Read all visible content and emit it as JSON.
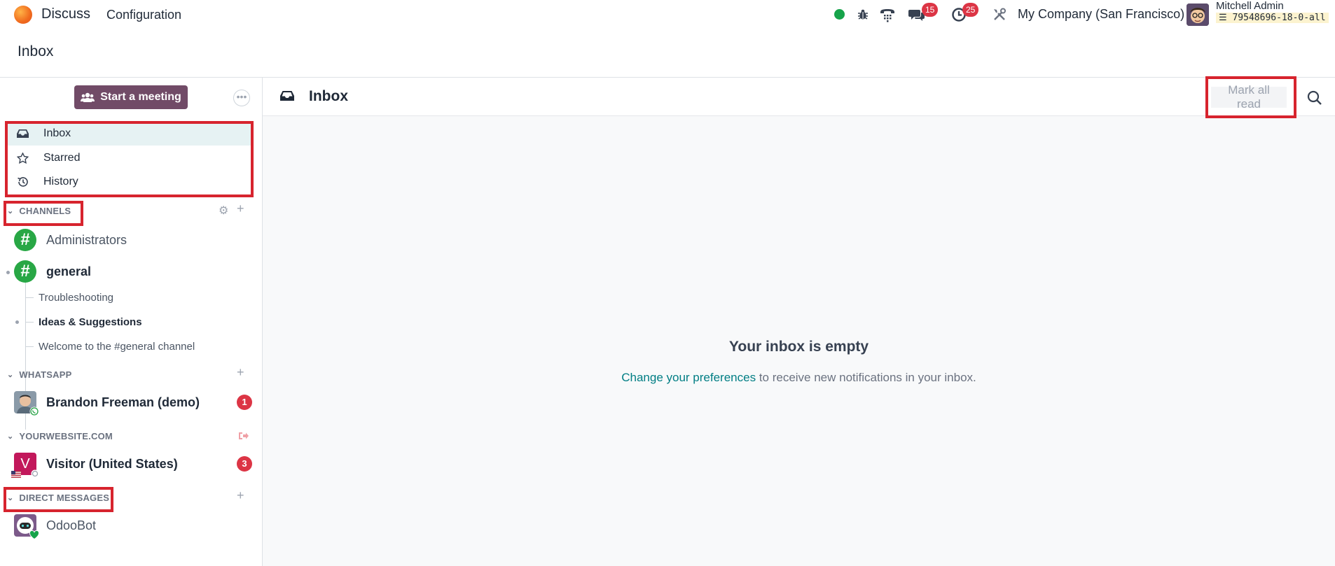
{
  "navbar": {
    "app_name": "Discuss",
    "menu_configuration": "Configuration",
    "messages_count": "15",
    "activities_count": "25",
    "company": "My Company (San Francisco)",
    "user_name": "Mitchell Admin",
    "database": "79548696-18-0-all",
    "icons": [
      "status-online-icon",
      "bug-icon",
      "phone-icon",
      "chat-bubbles-icon",
      "clock-icon",
      "tools-icon"
    ]
  },
  "control_panel": {
    "title": "Inbox"
  },
  "sidebar": {
    "start_meeting_label": "Start a meeting",
    "more_label": "•••",
    "mailboxes": [
      {
        "label": "Inbox",
        "icon": "inbox-icon",
        "active": true
      },
      {
        "label": "Starred",
        "icon": "star-icon",
        "active": false
      },
      {
        "label": "History",
        "icon": "history-icon",
        "active": false
      }
    ],
    "categories": {
      "channels": "CHANNELS",
      "whatsapp": "WHATSAPP",
      "website": "YOURWEBSITE.COM",
      "direct_messages": "DIRECT MESSAGES"
    },
    "channels": [
      {
        "name": "Administrators",
        "bold": false
      },
      {
        "name": "general",
        "bold": true
      }
    ],
    "sub_threads": [
      {
        "name": "Troubleshooting",
        "bold": false
      },
      {
        "name": "Ideas & Suggestions",
        "bold": true
      },
      {
        "name": "Welcome to the #general channel",
        "bold": false
      }
    ],
    "whatsapp_chat": {
      "name": "Brandon Freeman (demo)",
      "counter": "1"
    },
    "website_chat": {
      "name": "Visitor (United States)",
      "initial": "V",
      "counter": "3"
    },
    "direct_message": {
      "name": "OdooBot"
    }
  },
  "main": {
    "header_title": "Inbox",
    "mark_all_read": "Mark all read",
    "empty_title": "Your inbox is empty",
    "empty_link": "Change your preferences",
    "empty_rest": " to receive new notifications in your inbox."
  },
  "colors": {
    "brand": "#714b67",
    "accent_link": "#017e84",
    "badge": "#dc3545",
    "channel_green": "#28a745",
    "highlight_box": "#d7242e"
  }
}
